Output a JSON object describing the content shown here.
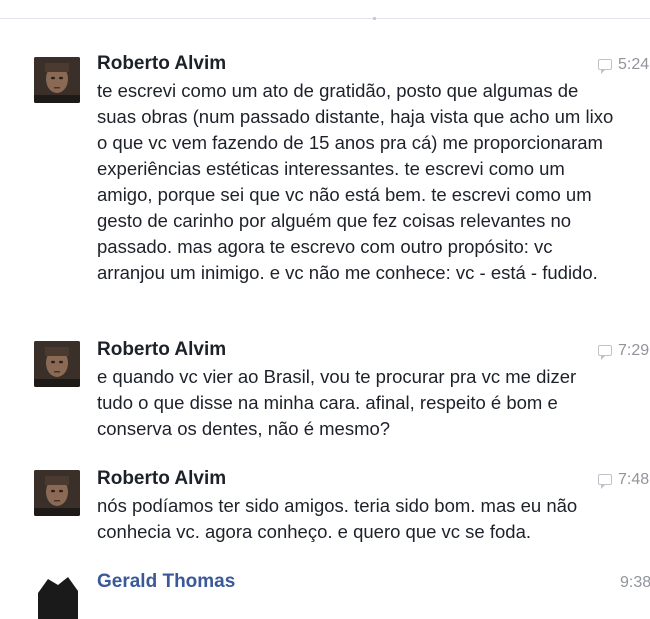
{
  "messages": [
    {
      "sender": "Roberto Alvim",
      "time": "5:24",
      "text": "te escrevi como um ato de gratidão, posto que algumas de suas obras (num passado distante, haja vista que acho um lixo o que vc vem fazendo de 15 anos pra cá) me proporcionaram experiências estéticas interessantes. te escrevi como um amigo, porque sei que vc não está bem. te escrevi como um gesto de carinho por alguém que fez coisas relevantes no passado. mas agora te escrevo com outro propósito: vc arranjou um inimigo. e vc não me conhece: vc - está - fudido."
    },
    {
      "sender": "Roberto Alvim",
      "time": "7:29",
      "text": "e quando vc vier ao Brasil, vou te procurar pra vc me dizer tudo o que disse na minha cara. afinal, respeito é bom e conserva os dentes, não é mesmo?"
    },
    {
      "sender": "Roberto Alvim",
      "time": "7:48",
      "text": "nós podíamos ter sido amigos. teria sido bom. mas eu não conhecia vc. agora conheço. e quero que vc se foda."
    },
    {
      "sender": "Gerald Thomas",
      "time": "9:38",
      "text": ""
    }
  ],
  "icons": {
    "reply": "reply-icon",
    "avatar": "avatar"
  },
  "colors": {
    "sender_default": "#1d2129",
    "sender_self": "#3b5998",
    "timestamp": "#90949c"
  }
}
